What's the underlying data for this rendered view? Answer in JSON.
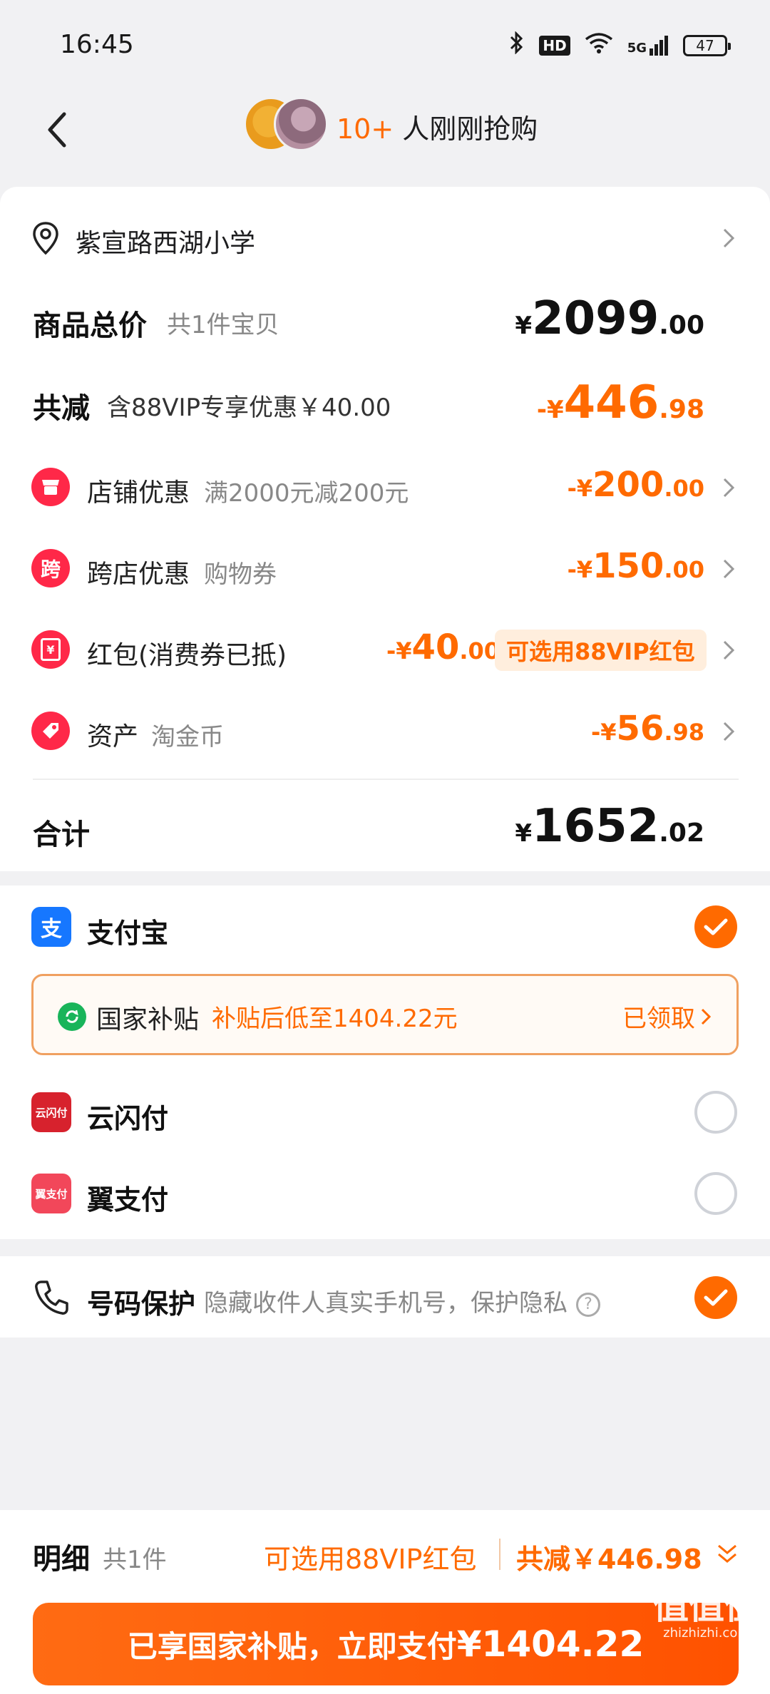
{
  "status_bar": {
    "time": "16:45",
    "hd": "HD",
    "network": "5G",
    "battery": "47"
  },
  "header": {
    "buyers_count": "10+",
    "buyers_text": " 人刚刚抢购"
  },
  "address": "紫宣路西湖小学",
  "summary": {
    "goods_total_label": "商品总价",
    "goods_count": "共1件宝贝",
    "goods_total": {
      "cur": "¥",
      "int": "2099",
      "dec": ".00"
    },
    "reduce_label": "共减",
    "reduce_note": "含88VIP专享优惠￥40.00",
    "reduce_total": {
      "cur": "-¥",
      "int": "446",
      "dec": ".98"
    }
  },
  "discounts": [
    {
      "icon": "店",
      "label": "店铺优惠",
      "sub": "满2000元减200元",
      "cur": "-¥",
      "int": "200",
      "dec": ".00"
    },
    {
      "icon": "跨",
      "label": "跨店优惠",
      "sub": "购物券",
      "cur": "-¥",
      "int": "150",
      "dec": ".00"
    },
    {
      "icon": "¥",
      "label": "红包(消费券已抵)",
      "sub": "",
      "cur": "-¥",
      "int": "40",
      "dec": ".00",
      "pill": "可选用88VIP红包"
    },
    {
      "icon": "",
      "label": "资产",
      "sub": "淘金币",
      "cur": "-¥",
      "int": "56",
      "dec": ".98"
    }
  ],
  "total": {
    "label": "合计",
    "cur": "¥",
    "int": "1652",
    "dec": ".02"
  },
  "payment": {
    "alipay": {
      "icon": "支",
      "label": "支付宝"
    },
    "subsidy": {
      "title": "国家补贴",
      "desc": "补贴后低至1404.22元",
      "status": "已领取"
    },
    "unionpay": {
      "icon": "云闪付",
      "label": "云闪付"
    },
    "bestpay": {
      "icon": "翼支付",
      "label": "翼支付"
    }
  },
  "privacy": {
    "label": "号码保护",
    "desc": "隐藏收件人真实手机号，保护隐私",
    "help": "?"
  },
  "bottom": {
    "detail_label": "明细",
    "detail_count": "共1件",
    "vip_hint": "可选用88VIP红包",
    "save": "共减￥446.98",
    "pay_text": "已享国家补贴，立即支付",
    "pay_amount": "¥1404.22"
  },
  "watermark": {
    "text": "值值值",
    "site": "zhizhizhi.com"
  },
  "colors": {
    "accent": "#ff6a00",
    "discount_icon": "#ff2848",
    "alipay": "#1677ff",
    "unionpay": "#d7222d",
    "bestpay": "#f2475a",
    "subsidy_icon": "#19b45a"
  }
}
